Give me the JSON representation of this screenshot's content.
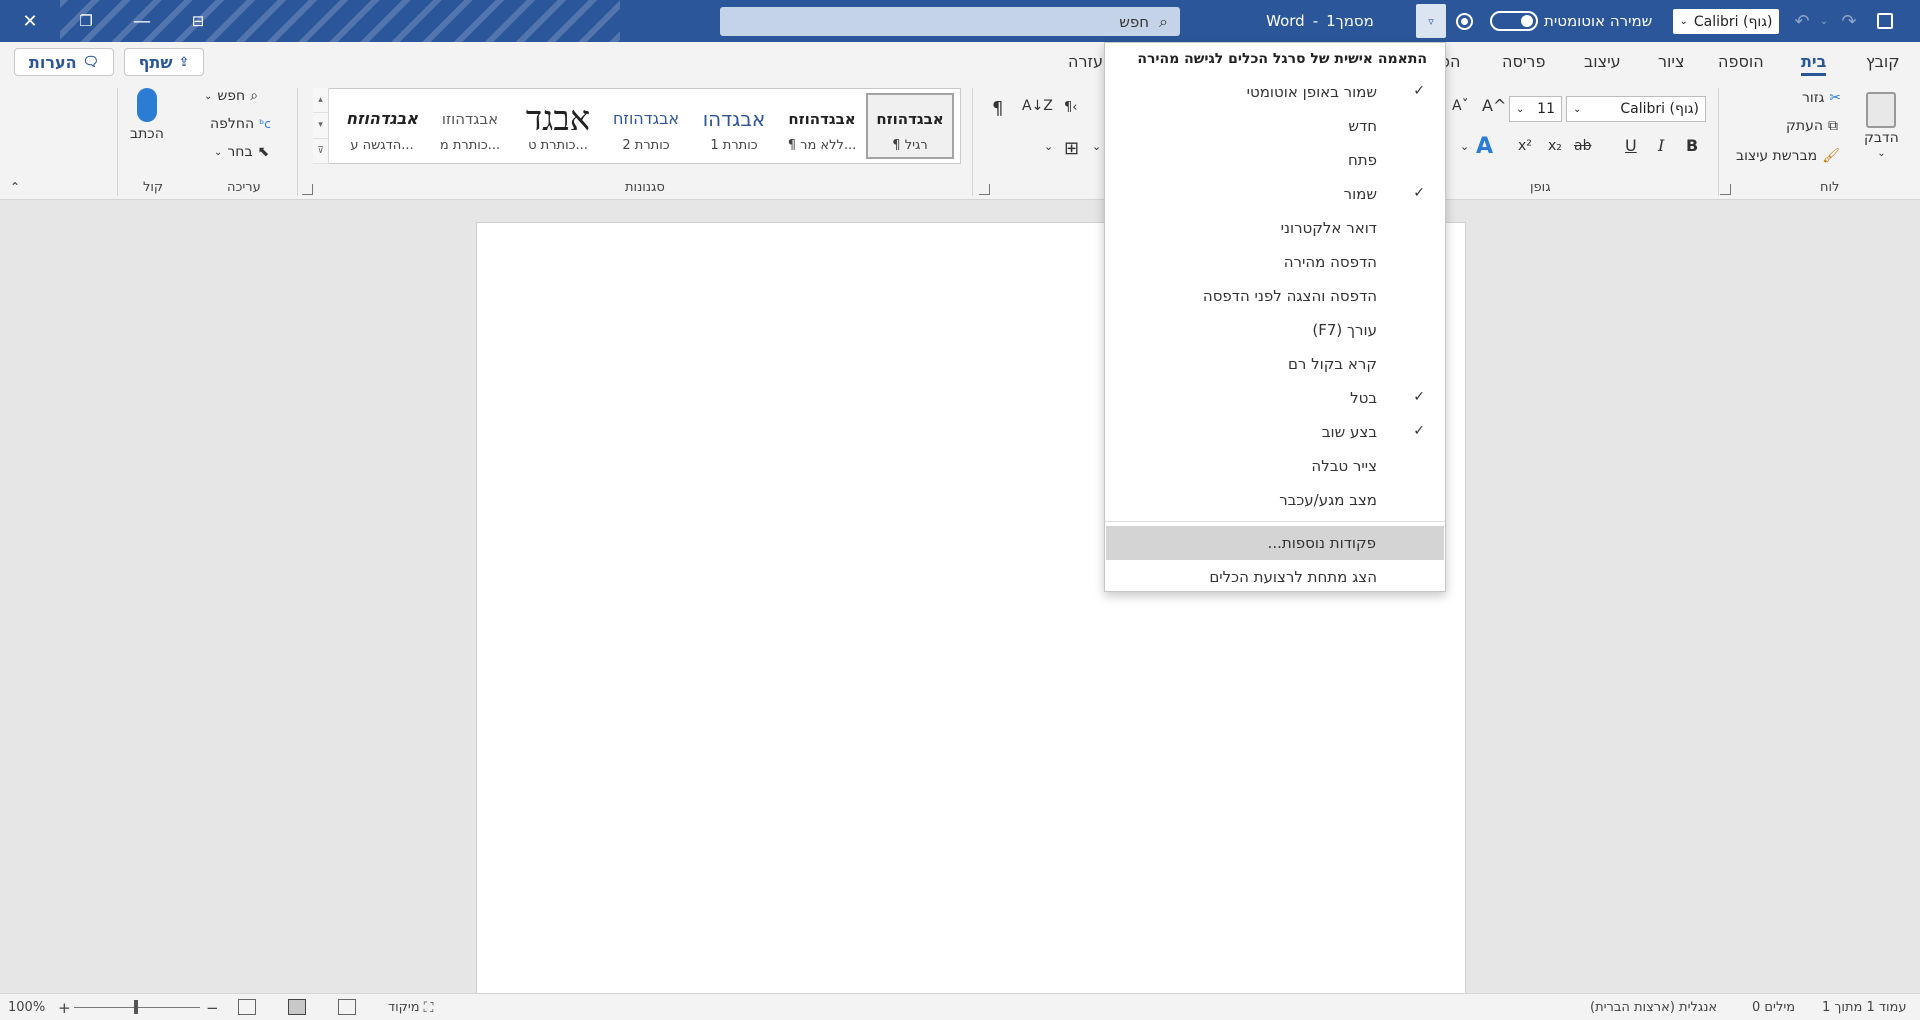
{
  "titlebar": {
    "app_name": "Word",
    "separator": "-",
    "doc_name": "מסמך1",
    "search_placeholder": "חפש",
    "autosave_label": "שמירה אוטומטית",
    "font_box": "Calibri (גוף)",
    "qat_icons": [
      "save-icon",
      "redo-icon",
      "undo-icon"
    ],
    "accent_color": "#2b579a"
  },
  "tabs": {
    "items": [
      "קובץ",
      "בית",
      "הוספה",
      "ציור",
      "עיצוב",
      "פריסה",
      "הפ",
      "עזרה"
    ],
    "active": "בית",
    "share_label": "שתף",
    "comments_label": "הערות"
  },
  "ribbon": {
    "clipboard": {
      "group_label": "לוח",
      "paste": "הדבק",
      "cut": "גזור",
      "copy": "העתק",
      "format_painter": "מברשת עיצוב"
    },
    "font": {
      "group_label": "גופן",
      "font_name": "Calibri (גוף)",
      "font_size": "11",
      "bold": "B",
      "italic": "I",
      "underline": "U",
      "strike": "ab",
      "subscript": "x₂",
      "superscript": "x²",
      "grow": "A^",
      "shrink": "Aˇ"
    },
    "paragraph": {
      "pilcrow": "¶"
    },
    "styles": {
      "group_label": "סגנונות",
      "items": [
        {
          "sample": "אבגדהוזח",
          "name": "¶ רגיל"
        },
        {
          "sample": "אבגדהוזח",
          "name": "¶ ללא מר..."
        },
        {
          "sample": "אבגדהו",
          "name": "כותרת 1"
        },
        {
          "sample": "אבגדהוזח",
          "name": "כותרת 2"
        },
        {
          "sample": "אבגד",
          "name": "כותרת ט..."
        },
        {
          "sample": "אבגדהוזו",
          "name": "כותרת מ..."
        },
        {
          "sample": "אבגדהוזח",
          "name": "הדגשה ע..."
        }
      ]
    },
    "editing": {
      "group_label": "עריכה",
      "find": "חפש",
      "replace": "החלפה",
      "select": "בחר"
    },
    "voice": {
      "group_label": "קול",
      "dictate": "הכתב"
    }
  },
  "qat_menu": {
    "header": "התאמה אישית של סרגל הכלים לגישה מהירה",
    "items": [
      {
        "label": "שמור באופן אוטומטי",
        "checked": true
      },
      {
        "label": "חדש",
        "checked": false
      },
      {
        "label": "פתח",
        "checked": false
      },
      {
        "label": "שמור",
        "checked": true
      },
      {
        "label": "דואר אלקטרוני",
        "checked": false
      },
      {
        "label": "הדפסה מהירה",
        "checked": false
      },
      {
        "label": "הדפסה והצגה לפני הדפסה",
        "checked": false
      },
      {
        "label": "עורך (F7)",
        "checked": false
      },
      {
        "label": "קרא בקול רם",
        "checked": false
      },
      {
        "label": "בטל",
        "checked": true
      },
      {
        "label": "בצע שוב",
        "checked": true
      },
      {
        "label": "צייר טבלה",
        "checked": false
      },
      {
        "label": "מצב מגע/עכבר",
        "checked": false
      }
    ],
    "more_commands": "פקודות נוספות...",
    "show_below": "הצג מתחת לרצועת הכלים",
    "check_mark": "✓"
  },
  "statusbar": {
    "page_info": "עמוד 1 מתוך 1",
    "words": "0 מילים",
    "language": "אנגלית (ארצות הברית)",
    "focus": "מיקוד",
    "zoom_percent": "100%",
    "zoom_minus": "−",
    "zoom_plus": "+"
  }
}
